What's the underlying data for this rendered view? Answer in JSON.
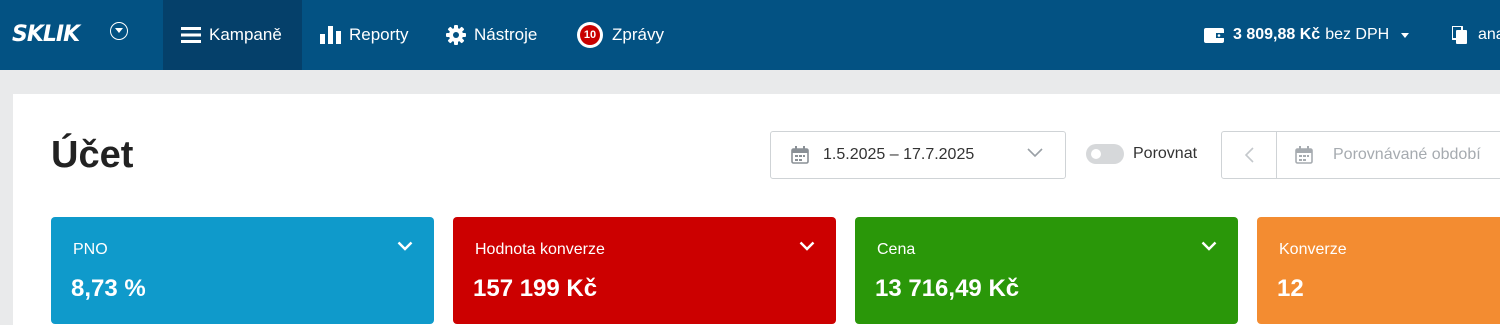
{
  "topbar": {
    "logo_text": "SKLIK",
    "nav": [
      {
        "label": "Kampaně",
        "icon": "menu-icon",
        "active": true
      },
      {
        "label": "Reporty",
        "icon": "bar-chart-icon",
        "active": false
      },
      {
        "label": "Nástroje",
        "icon": "gear-icon",
        "active": false
      },
      {
        "label": "Zprávy",
        "icon": "messages-badge-icon",
        "badge": "10",
        "active": false
      }
    ],
    "wallet": {
      "amount": "3 809,88 Kč",
      "suffix": "bez DPH",
      "icon": "wallet-icon"
    },
    "account": {
      "label": "ana",
      "icon": "copy-icon"
    }
  },
  "page": {
    "title": "Účet",
    "date_range": "1.5.2025 – 17.7.2025",
    "compare_label": "Porovnat",
    "compare_enabled": false,
    "compare_placeholder": "Porovnávané období"
  },
  "tiles": [
    {
      "label": "PNO",
      "value": "8,73 %",
      "color": "#0f9acb"
    },
    {
      "label": "Hodnota konverze",
      "value": "157 199 Kč",
      "color": "#cc0000"
    },
    {
      "label": "Cena",
      "value": "13 716,49 Kč",
      "color": "#2a9709"
    },
    {
      "label": "Konverze",
      "value": "12",
      "color": "#f38c31"
    }
  ],
  "colors": {
    "topbar": "#035283",
    "topbar_active": "#05406a",
    "badge": "#c80000"
  }
}
